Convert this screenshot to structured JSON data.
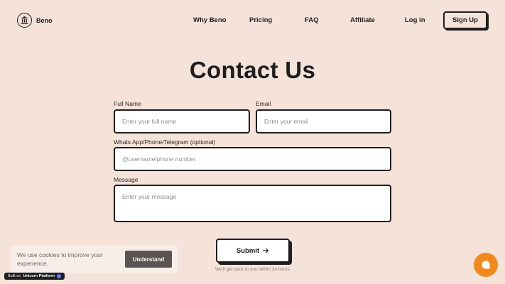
{
  "header": {
    "brand": "Beno",
    "nav": [
      "Why Beno",
      "Pricing",
      "FAQ",
      "Affiliate",
      "Log in"
    ],
    "signup_label": "Sign Up"
  },
  "main": {
    "title": "Contact Us",
    "form": {
      "full_name_label": "Full Name",
      "full_name_placeholder": "Enter your full name",
      "email_label": "Email",
      "email_placeholder": "Enter your email",
      "contact_label": "Whats App/Phone/Telegram (optional)",
      "contact_placeholder": "@username/phone number",
      "message_label": "Message",
      "message_placeholder": "Enter your message",
      "submit_label": "Submit",
      "note": "We'll get back to you within 24 hours"
    }
  },
  "cookie": {
    "text": "We use cookies to improve your experience.",
    "button": "Understand"
  },
  "badge": {
    "prefix": "Built on",
    "name": "Unicorn Platform"
  },
  "icons": {
    "logo": "temple-logo-icon",
    "arrow": "arrow-right-icon",
    "chat": "chat-bubble-icon"
  },
  "colors": {
    "background": "#f5e2d8",
    "text": "#1e1e1e",
    "chat": "#f08a1c",
    "cookie_button": "#5a5553"
  }
}
